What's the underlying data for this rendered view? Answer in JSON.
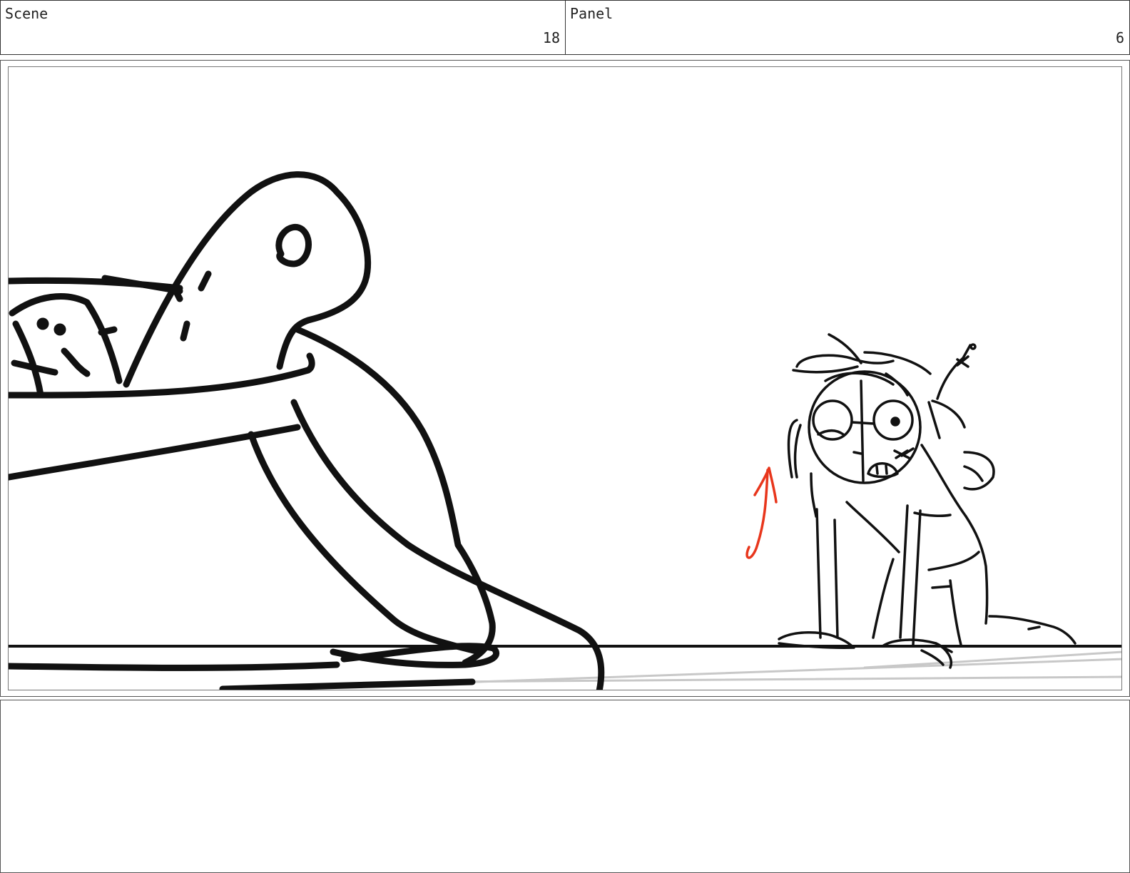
{
  "header": {
    "scene_label": "Scene",
    "scene_number": "18",
    "panel_label": "Panel",
    "panel_number": "6"
  },
  "colors": {
    "ink": "#111111",
    "floor_shadow": "#c8c8c8",
    "motion_arrow": "#e8361c",
    "frame_border": "#555555"
  },
  "icons": {
    "motion_arrow": "upward-arrow-icon"
  }
}
